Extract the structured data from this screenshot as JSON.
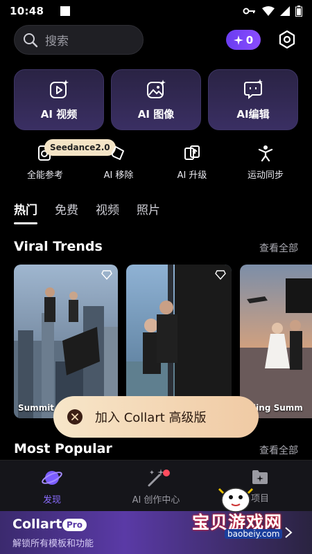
{
  "status_bar": {
    "time": "10:48"
  },
  "search": {
    "placeholder": "搜索"
  },
  "credits": {
    "count": "0"
  },
  "tools": [
    {
      "label": "AI 视频",
      "icon": "video-sparkle-icon"
    },
    {
      "label": "AI 图像",
      "icon": "image-sparkle-icon"
    },
    {
      "label": "AI编辑",
      "icon": "chat-edit-icon"
    }
  ],
  "mini_tools": [
    {
      "label": "全能参考",
      "icon": "reference-icon",
      "badge": "Seedance2.0"
    },
    {
      "label": "AI 移除",
      "icon": "eraser-icon"
    },
    {
      "label": "AI 升级",
      "icon": "upscale-icon"
    },
    {
      "label": "运动同步",
      "icon": "motion-icon"
    }
  ],
  "tabs": [
    "热门",
    "免费",
    "视频",
    "照片"
  ],
  "sections": {
    "viral": {
      "title": "Viral Trends",
      "see_all": "查看全部"
    },
    "popular": {
      "title": "Most Popular",
      "see_all": "查看全部"
    }
  },
  "cards": [
    {
      "caption": "Summit"
    },
    {
      "caption": ""
    },
    {
      "caption": "dding Summ"
    }
  ],
  "toast": {
    "text": "加入 Collart 高级版"
  },
  "bottom_nav": [
    {
      "label": "发现",
      "icon": "planet-icon",
      "active": true
    },
    {
      "label": "AI 创作中心",
      "icon": "magic-wand-icon",
      "active": false
    },
    {
      "label": "项目",
      "icon": "folder-icon",
      "active": false
    }
  ],
  "pro_banner": {
    "name": "Collart",
    "tag": "Pro",
    "subtitle": "解锁所有模板和功能"
  },
  "watermark": {
    "title": "宝贝游戏网",
    "url": "baobeiy.com"
  },
  "colors": {
    "accent": "#8a6cff",
    "toast_bg": "#f4dcb8",
    "card_bg": "#2e2650"
  }
}
